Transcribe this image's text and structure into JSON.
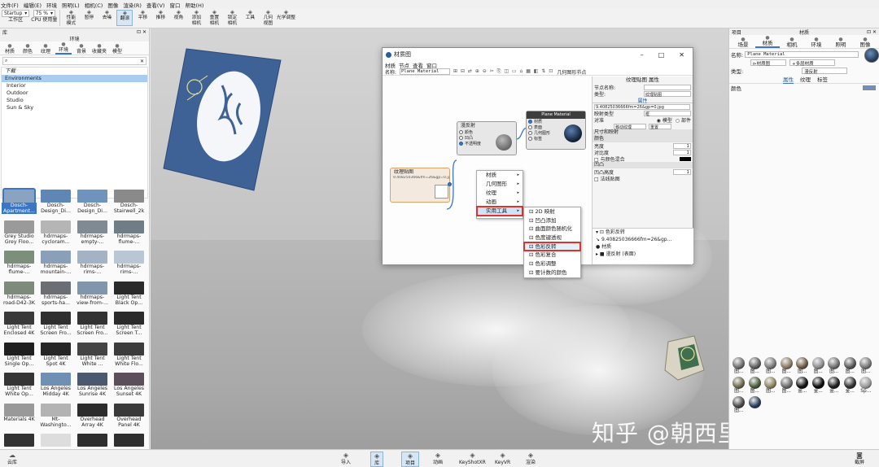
{
  "menubar": [
    "文件(F)",
    "编辑(E)",
    "环境",
    "照明(L)",
    "相机(C)",
    "图像",
    "渲染(R)",
    "查看(V)",
    "窗口",
    "帮助(H)"
  ],
  "toolbar": {
    "workspace_value": "Startup",
    "workspace_label": "工作区",
    "cpu_value": "75 %",
    "cpu_label": "CPU 使用量",
    "buttons": [
      {
        "label": "性能\n模式",
        "icon": "performance-icon"
      },
      {
        "label": "暂停",
        "icon": "pause-icon"
      },
      {
        "label": "去噪",
        "icon": "denoise-icon"
      },
      {
        "label": "翻滚",
        "icon": "tumble-icon",
        "active": true
      },
      {
        "label": "平移",
        "icon": "pan-icon"
      },
      {
        "label": "推移",
        "icon": "dolly-icon"
      },
      {
        "label": "视角",
        "icon": "fov-icon"
      },
      {
        "label": "添加\n相机",
        "icon": "add-camera-icon"
      },
      {
        "label": "重置\n相机",
        "icon": "reset-camera-icon"
      },
      {
        "label": "锁定\n相机",
        "icon": "lock-camera-icon"
      },
      {
        "label": "工具",
        "icon": "tools-icon"
      },
      {
        "label": "几何\n视图",
        "icon": "geometry-view-icon"
      },
      {
        "label": "光学调整",
        "icon": "optics-icon"
      }
    ]
  },
  "left_panel": {
    "header": "库",
    "subheader": "环境",
    "tabs": [
      "材质",
      "颜色",
      "纹理",
      "环境",
      "背景",
      "收藏夹",
      "模型"
    ],
    "active_tab": "环境",
    "search_placeholder": "",
    "tree": {
      "root": "下载",
      "items": [
        "Environments",
        "Interior",
        "Outdoor",
        "Studio",
        "Sun & Sky"
      ],
      "selected": "Environments"
    },
    "thumbnails": [
      {
        "label": "Dosch-\nApartment...",
        "color": "#8aa3c0",
        "selected": true
      },
      {
        "label": "Dosch-\nDesign_Di...",
        "color": "#5f87b5"
      },
      {
        "label": "Dosch-\nDesign_Di...",
        "color": "#6e93bd"
      },
      {
        "label": "Dosch-\nStairwell_2k",
        "color": "#8a8a8a"
      },
      {
        "label": "Grey Studio\nGrey Floo...",
        "color": "#9a9a9a"
      },
      {
        "label": "hdrmaps-\ncycloram...",
        "color": "#b5b5b5"
      },
      {
        "label": "hdrmaps-\nempty-...",
        "color": "#7f8a93"
      },
      {
        "label": "hdrmaps-\nflume-...",
        "color": "#6f7d86"
      },
      {
        "label": "hdrmaps-\nflume-...",
        "color": "#7b8f7b"
      },
      {
        "label": "hdrmaps-\nmountain-...",
        "color": "#8aa0b8"
      },
      {
        "label": "hdrmaps-\nrims-...",
        "color": "#a3b2c4"
      },
      {
        "label": "hdrmaps-\nrims-...",
        "color": "#b9c6d3"
      },
      {
        "label": "hdrmaps-\nroad-D42-3K",
        "color": "#7d8a7c"
      },
      {
        "label": "hdrmaps-\nsports-ha...",
        "color": "#6b6f73"
      },
      {
        "label": "hdrmaps-\nview-from-...",
        "color": "#8096ad"
      },
      {
        "label": "Light Tent\nBlack Op...",
        "color": "#2a2a2a"
      },
      {
        "label": "Light Tent\nEnclosed 4K",
        "color": "#3a3a3a"
      },
      {
        "label": "Light Tent\nScreen Fro...",
        "color": "#2f2f2f"
      },
      {
        "label": "Light Tent\nScreen Fro...",
        "color": "#333333"
      },
      {
        "label": "Light Tent\nScreen T...",
        "color": "#2b2b2b"
      },
      {
        "label": "Light Tent\nSingle Op...",
        "color": "#1f1f1f"
      },
      {
        "label": "Light Tent\nSpot 4K",
        "color": "#262626"
      },
      {
        "label": "Light Tent\nWhite ...",
        "color": "#444444"
      },
      {
        "label": "Light Tent\nWhite Flo...",
        "color": "#3c3c3c"
      },
      {
        "label": "Light Tent\nWhite Op...",
        "color": "#353535"
      },
      {
        "label": "Los Angeles\nMidday 4K",
        "color": "#6f8fb3"
      },
      {
        "label": "Los Angeles\nSunrise 4K",
        "color": "#4a5870"
      },
      {
        "label": "Los Angeles\nSunset 4K",
        "color": "#5b4f5a"
      },
      {
        "label": "Materials 4K",
        "color": "#999999"
      },
      {
        "label": "Mt-\nWashingto...",
        "color": "#b3b3b3"
      },
      {
        "label": "Overhead\nArray 4K",
        "color": "#2c2c2c"
      },
      {
        "label": "Overhead\nPanel 4K",
        "color": "#3a3a3a"
      },
      {
        "label": "",
        "color": "#333333"
      },
      {
        "label": "",
        "color": "#dddddd"
      },
      {
        "label": "",
        "color": "#2f2f2f"
      },
      {
        "label": "",
        "color": "#2f2f2f"
      }
    ]
  },
  "material_window": {
    "title": "材质图",
    "menu": [
      "材质",
      "节点",
      "查看",
      "窗口"
    ],
    "name_label": "名称:",
    "name_value": "Plane Material",
    "tools_trailing": "几何图形节点",
    "nodes": {
      "texture": {
        "title": "纹理贴图",
        "file": "9.408250366&fm=26&gp=0.jpg"
      },
      "diffuse": {
        "title": "漫反射",
        "ports": [
          "颜色",
          "凹凸",
          "不透明度"
        ]
      },
      "material": {
        "title": "Plane Material",
        "ports": [
          "材质",
          "表面",
          "几何图形",
          "标签"
        ]
      }
    },
    "props": {
      "header": "纹理贴图 属性",
      "node_name_label": "节点名称:",
      "type_label": "类型:",
      "type_value": "纹理贴图",
      "attr_tab": "属性",
      "file_value": "9.40825036666fm=26&gp=0.jpg",
      "mapping_label": "映射类型",
      "mapping_value": "框",
      "align_label": "对准",
      "align_options": [
        "模型",
        "部件"
      ],
      "move_texture": "移动纹理",
      "reset": "重置",
      "sec_size": "尺寸和映射",
      "sec_color": "颜色",
      "brightness_label": "亮度",
      "brightness_value": "1",
      "contrast_label": "对比度",
      "contrast_value": "1",
      "color_blend_label": "与颜色混合",
      "sec_bump": "凹凸",
      "bump_height_label": "凹凸高度",
      "bump_height_value": "1",
      "normal_map_label": "法线贴图",
      "lower_items": [
        "色彩反转",
        "9.40825036666fm=26&gp...",
        "材质",
        "漫反射 (表面)"
      ]
    }
  },
  "context_menu": {
    "items": [
      "材质",
      "几何图形",
      "纹理",
      "动画",
      "实用工具"
    ],
    "highlighted": "实用工具"
  },
  "sub_menu": {
    "items": [
      "2D 映射",
      "凹凸添加",
      "曲面颜色随机化",
      "色度键透视",
      "色彩反转",
      "色彩复合",
      "色彩调整",
      "要计数的颜色"
    ],
    "highlighted": "色彩反转"
  },
  "right_panel": {
    "header_left": "项目",
    "header": "材质",
    "tabs": [
      "场景",
      "材质",
      "相机",
      "环境",
      "照明",
      "图像"
    ],
    "active_tab": "材质",
    "name_label": "名称:",
    "name_value": "Plane Material",
    "texture_map_btn": "材质图",
    "multilayer_btn": "多层材质",
    "type_label": "类型:",
    "type_value": "漫反射",
    "sub_tabs": [
      "属性",
      "纹理",
      "标签"
    ],
    "active_sub_tab": "属性",
    "color_label": "颜色",
    "color_swatch": "#6e8fc0",
    "materials": [
      {
        "label": "图...",
        "color": "#6d6d6d"
      },
      {
        "label": "图...",
        "color": "#5e5e5e"
      },
      {
        "label": "图...",
        "color": "#7a7a7a"
      },
      {
        "label": "图...",
        "color": "#8a7a66"
      },
      {
        "label": "图...",
        "color": "#6e5a44"
      },
      {
        "label": "图...",
        "color": "#8d8d8d"
      },
      {
        "label": "图...",
        "color": "#6f6f6f"
      },
      {
        "label": "图...",
        "color": "#585858"
      },
      {
        "label": "图...",
        "color": "#777777"
      },
      {
        "label": "图...",
        "color": "#6e6850"
      },
      {
        "label": "图...",
        "color": "#4b5a3a"
      },
      {
        "label": "图...",
        "color": "#8c8460"
      },
      {
        "label": "图...",
        "color": "#6b6b6b"
      },
      {
        "label": "金...",
        "color": "#111111"
      },
      {
        "label": "金...",
        "color": "#0a0a0a"
      },
      {
        "label": "金...",
        "color": "#1c1c1c"
      },
      {
        "label": "金...",
        "color": "#303030"
      },
      {
        "label": "Sp...",
        "color": "#9a9a9a"
      },
      {
        "label": "图...",
        "color": "#4a4a4a"
      },
      {
        "label": "",
        "color": "#2a3c5a"
      }
    ]
  },
  "bottombar": {
    "left": "云库",
    "center": [
      {
        "label": "导入",
        "icon": "import-icon"
      },
      {
        "label": "库",
        "icon": "library-icon",
        "active": true
      },
      {
        "label": "项目",
        "icon": "project-icon",
        "active": true
      },
      {
        "label": "动画",
        "icon": "animation-icon"
      },
      {
        "label": "KeyShotXR",
        "icon": "keyshotxr-icon"
      },
      {
        "label": "KeyVR",
        "icon": "keyvr-icon"
      },
      {
        "label": "渲染",
        "icon": "render-icon"
      }
    ],
    "right": "截屏"
  },
  "watermark": "知乎 @朝西里设计学院"
}
